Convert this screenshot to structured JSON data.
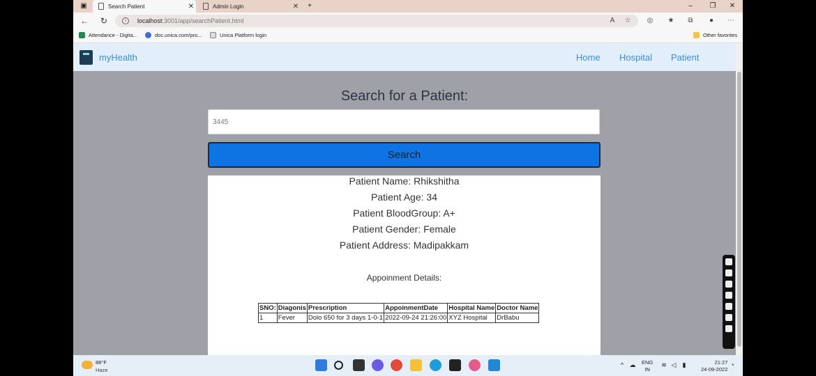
{
  "browser": {
    "tabs": [
      {
        "label": "Search Patient",
        "active": true
      },
      {
        "label": "Admin Login",
        "active": false
      }
    ],
    "url_host": "localhost",
    "url_path": ":3001/app/searchPatient.html",
    "favorites": [
      {
        "label": "Attendance - Digita..."
      },
      {
        "label": "doc.unica.com/pro..."
      },
      {
        "label": "Unica Platform login"
      }
    ],
    "other_favorites": "Other favorites"
  },
  "navbar": {
    "brand": "myHealth",
    "links": [
      "Home",
      "Hospital",
      "Patient"
    ]
  },
  "search": {
    "heading": "Search for a Patient:",
    "input_value": "3445",
    "button_label": "Search"
  },
  "patient": {
    "name_line": "Patient Name: Rhikshitha",
    "age_line": "Patient Age: 34",
    "blood_line": "Patient BloodGroup: A+",
    "gender_line": "Patient Gender: Female",
    "address_line": "Patient Address: Madipakkam"
  },
  "appointments": {
    "title": "Appoinment Details:",
    "columns": [
      "SNO:",
      "Diagonis",
      "Prescription",
      "AppoinmentDate",
      "Hospital Name",
      "Doctor Name"
    ],
    "rows": [
      [
        "1",
        "Fever",
        "Dolo 650 for 3 days 1-0-1",
        "2022-09-24 21:26:00",
        "XYZ Hospital",
        "DrBabu"
      ]
    ]
  },
  "taskbar": {
    "temperature": "88°F",
    "weather": "Haze",
    "language_top": "ENG",
    "language_bottom": "IN",
    "time": "21:27",
    "date": "24-09-2022"
  },
  "colors": {
    "accent_button": "#0f74e3",
    "nav_link": "#3a8fcf",
    "page_background": "#a0a1a8"
  }
}
